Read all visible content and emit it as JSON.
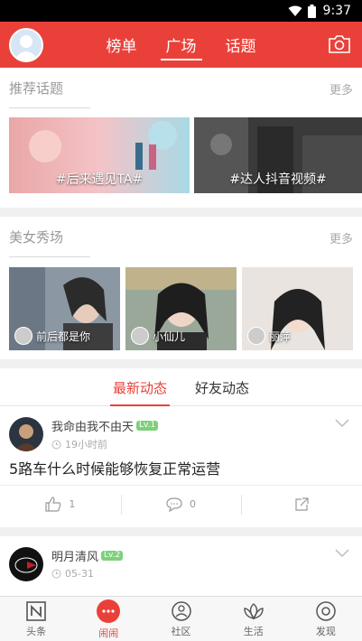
{
  "status": {
    "time": "9:37",
    "wifi_icon": "wifi-icon",
    "battery_icon": "battery-icon"
  },
  "header": {
    "tabs": [
      {
        "label": "榜单"
      },
      {
        "label": "广场"
      },
      {
        "label": "话题"
      }
    ],
    "active_tab": "广场",
    "accent": "#e9413a"
  },
  "recommended": {
    "title": "推荐话题",
    "more": "更多",
    "cards": [
      {
        "caption": "#后来遇见TA#"
      },
      {
        "caption": "#达人抖音视频#"
      }
    ]
  },
  "beauty": {
    "title": "美女秀场",
    "more": "更多",
    "cards": [
      {
        "name": "前后都是你"
      },
      {
        "name": "小仙儿"
      },
      {
        "name": "丽萍"
      }
    ]
  },
  "feed_tabs": [
    {
      "label": "最新动态"
    },
    {
      "label": "好友动态"
    }
  ],
  "posts": [
    {
      "user": "我命由我不由天",
      "level": "Lv.1",
      "time": "19小时前",
      "text": "5路车什么时候能够恢复正常运营",
      "likes": "1",
      "comments": "0"
    },
    {
      "user": "明月清风",
      "level": "Lv.2",
      "time": "05-31"
    }
  ],
  "bottom_nav": [
    {
      "label": "头条",
      "icon": "news-icon"
    },
    {
      "label": "闹闹",
      "icon": "chat-bubble-icon"
    },
    {
      "label": "社区",
      "icon": "community-icon"
    },
    {
      "label": "生活",
      "icon": "lotus-icon"
    },
    {
      "label": "发现",
      "icon": "compass-icon"
    }
  ]
}
